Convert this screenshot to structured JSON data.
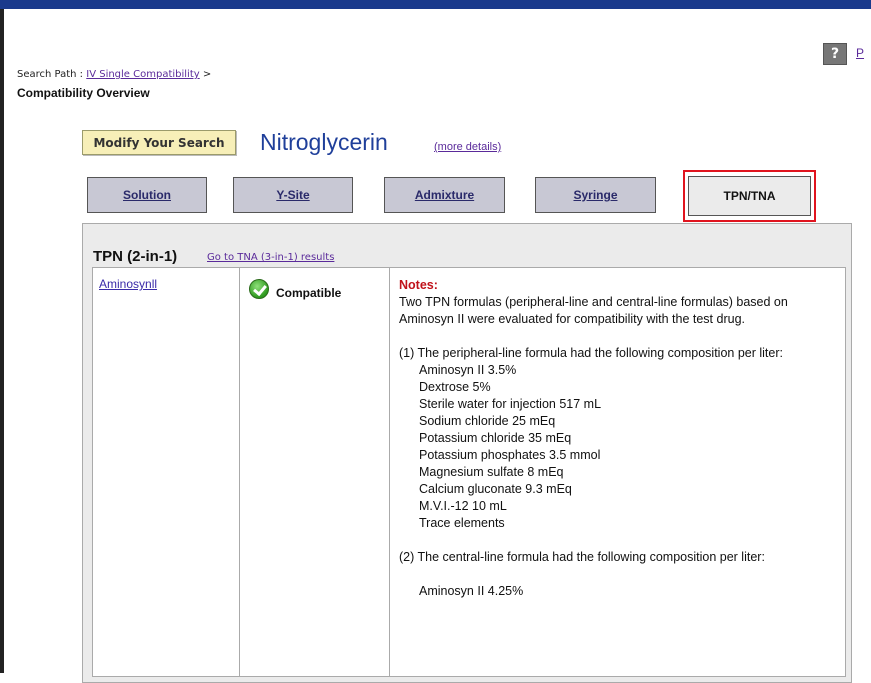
{
  "help": {
    "icon_glyph": "?",
    "link_label": "P"
  },
  "breadcrumb": {
    "prefix": "Search Path :",
    "link": "IV Single Compatibility",
    "separator": ">"
  },
  "page_title": "Compatibility Overview",
  "modify_button": "Modify Your Search",
  "drug": {
    "name": "Nitroglycerin",
    "more_details": "(more details)"
  },
  "tabs": [
    {
      "label": "Solution"
    },
    {
      "label": "Y-Site"
    },
    {
      "label": "Admixture"
    },
    {
      "label": "Syringe"
    },
    {
      "label": "TPN/TNA",
      "active": true
    }
  ],
  "section": {
    "title": "TPN (2-in-1)",
    "tna_link": "Go to TNA (3-in-1) results"
  },
  "row": {
    "solution": "Aminosynll",
    "status": "Compatible",
    "status_icon": "check-circle-icon",
    "notes_label": "Notes:",
    "notes_intro": "Two TPN formulas (peripheral-line and central-line formulas) based on Aminosyn II were evaluated for compatibility with the test drug.",
    "peripheral_heading": "(1) The peripheral-line formula had the following composition per liter:",
    "peripheral_items": [
      "Aminosyn II 3.5%",
      "Dextrose 5%",
      "Sterile water for injection 517 mL",
      "Sodium chloride 25 mEq",
      "Potassium chloride 35 mEq",
      "Potassium phosphates 3.5 mmol",
      "Magnesium sulfate 8 mEq",
      "Calcium gluconate 9.3 mEq",
      "M.V.I.-12 10 mL",
      "Trace elements"
    ],
    "central_heading": "(2) The central-line formula had the following composition per liter:",
    "central_items": [
      "Aminosyn II 4.25%"
    ]
  },
  "colors": {
    "accent_red": "#e0141e",
    "title_blue": "#1f3f9a",
    "button_yellow": "#f7efb8",
    "notes_red": "#c0121a"
  }
}
